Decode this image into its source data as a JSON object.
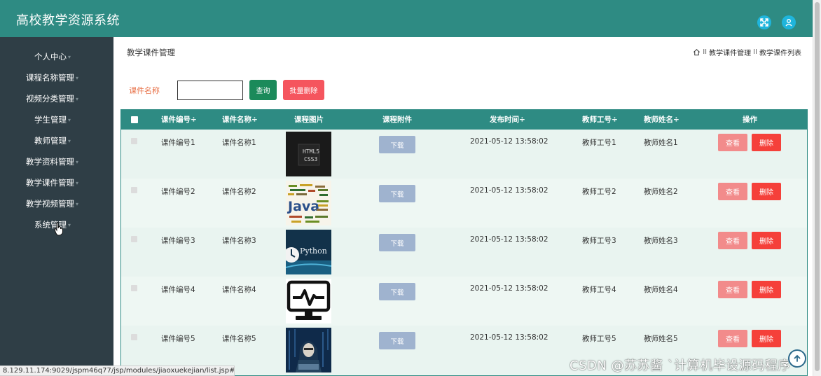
{
  "app": {
    "title": "高校教学资源系统"
  },
  "sidebar": {
    "items": [
      {
        "label": "个人中心"
      },
      {
        "label": "课程名称管理"
      },
      {
        "label": "视频分类管理"
      },
      {
        "label": "学生管理"
      },
      {
        "label": "教师管理"
      },
      {
        "label": "教学资料管理"
      },
      {
        "label": "教学课件管理"
      },
      {
        "label": "教学视频管理"
      },
      {
        "label": "系统管理"
      }
    ],
    "caret": "▾"
  },
  "page": {
    "title": "教学课件管理"
  },
  "breadcrumb": {
    "sep": "II",
    "items": [
      "教学课件管理",
      "教学课件列表"
    ]
  },
  "search": {
    "label": "课件名称",
    "value": "",
    "query_label": "查询",
    "batch_delete_label": "批量删除"
  },
  "table": {
    "headers": [
      "课件编号÷",
      "课件名称÷",
      "课程图片",
      "课程附件",
      "发布时间÷",
      "教师工号÷",
      "教师姓名÷",
      "操作"
    ],
    "download_label": "下载",
    "view_label": "查看",
    "delete_label": "删除",
    "rows": [
      {
        "code": "课件编号1",
        "name": "课件名称1",
        "image": "html5-css3-cover",
        "time": "2021-05-12 13:58:02",
        "teacher_id": "教师工号1",
        "teacher_name": "教师姓名1"
      },
      {
        "code": "课件编号2",
        "name": "课件名称2",
        "image": "java-wordcloud-cover",
        "time": "2021-05-12 13:58:02",
        "teacher_id": "教师工号2",
        "teacher_name": "教师姓名2"
      },
      {
        "code": "课件编号3",
        "name": "课件名称3",
        "image": "python-cover",
        "time": "2021-05-12 13:58:02",
        "teacher_id": "教师工号3",
        "teacher_name": "教师姓名3"
      },
      {
        "code": "课件编号4",
        "name": "课件名称4",
        "image": "monitor-pulse-icon",
        "time": "2021-05-12 13:58:02",
        "teacher_id": "教师工号4",
        "teacher_name": "教师姓名4"
      },
      {
        "code": "课件编号5",
        "name": "课件名称5",
        "image": "hacker-cover",
        "time": "2021-05-12 13:58:02",
        "teacher_id": "教师工号5",
        "teacher_name": "教师姓名5"
      }
    ],
    "image_texts": {
      "html5": "HTML5",
      "css3": "CSS3",
      "java": "Java",
      "python": "Python"
    }
  },
  "status_bar": {
    "url": "8.129.11.174:9029/jspm46q77/jsp/modules/jiaoxuekejian/list.jsp#"
  },
  "watermark": {
    "text": "CSDN @苏苏酱  `计算机毕设源码程序"
  },
  "colors": {
    "header": "#2e8b83",
    "sidebar": "#2f3e46",
    "query": "#1b8a5a",
    "danger": "#f5403a",
    "view": "#f28b8b",
    "download": "#9fb3cf"
  }
}
